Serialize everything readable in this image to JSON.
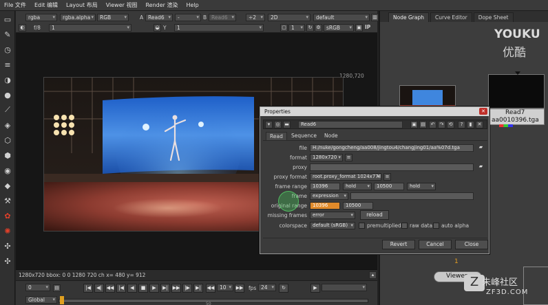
{
  "menubar": {
    "items": [
      "File 文件",
      "Edit 编辑",
      "Layout 布局",
      "Viewer 视图",
      "Render 渲染",
      "Help"
    ]
  },
  "viewer_toolbar": {
    "channels": "rgba",
    "channel_alpha": "rgba.alpha",
    "display": "RGB",
    "input_a_label": "A",
    "input_a": "Read6",
    "dash": "-",
    "input_b_label": "B",
    "input_b": "Read6",
    "gain": "÷2",
    "mode": "2D",
    "lut": "default",
    "fstop": "f/8",
    "exposure": "1",
    "y_label": "Y",
    "gamma": "1",
    "proxy": "1",
    "colorspace": "sRGB",
    "ip_label": "IP"
  },
  "viewport": {
    "resolution_label": "1280,720",
    "status_text": "1280x720 bbox: 0 0 1280 720 ch  x= 480 y= 912"
  },
  "timeline": {
    "current_frame": "0",
    "step": "10",
    "fps_label": "fps",
    "fps": "24",
    "global_label": "Global",
    "frame_marker": "50"
  },
  "node_graph": {
    "tabs": [
      "Node Graph",
      "Curve Editor",
      "Dope Sheet"
    ],
    "active_tab": "Node Graph",
    "read7_label": "Read7",
    "read7_file": "aa0010396.tga",
    "viewer_label": "Viewer",
    "viewer_input": "1"
  },
  "watermark": {
    "youku_en": "YOUKU",
    "youku_cn": "优酷",
    "site_cn": "朱峰社区",
    "site_en": "ZF3D.COM"
  },
  "properties": {
    "window_title": "Properties",
    "node_name": "Read6",
    "tabs": [
      "Read",
      "Sequence",
      "Node"
    ],
    "active_tab": "Read",
    "file_label": "file",
    "file_value": "H:/nuke/gongcheng/aa008/jingtou4/changjing01/aa%07d.tga",
    "format_label": "format",
    "format_value": "1280x720",
    "proxy_label": "proxy",
    "proxy_value": "",
    "proxy_format_label": "proxy format",
    "proxy_format_value": "root.proxy_format 1024x778",
    "frame_range_label": "frame range",
    "frame_range_start": "10396",
    "frame_range_before": "hold",
    "frame_range_end": "10500",
    "frame_range_after": "hold",
    "frame_label": "frame",
    "frame_mode": "expression",
    "original_range_label": "original range",
    "original_range_start": "10396",
    "original_range_end": "10500",
    "missing_frames_label": "missing frames",
    "missing_frames_value": "error",
    "reload_label": "reload",
    "colorspace_label": "colorspace",
    "colorspace_value": "default (sRGB)",
    "premultiplied_label": "premultiplied",
    "raw_data_label": "raw data",
    "auto_alpha_label": "auto alpha",
    "revert_label": "Revert",
    "cancel_label": "Cancel",
    "close_label": "Close"
  }
}
